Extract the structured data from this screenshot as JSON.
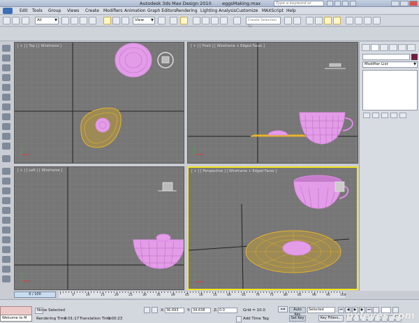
{
  "window": {
    "app_title": "Autodesk 3ds Max Design 2010",
    "file_name": "eggsMaking.max",
    "help_search_placeholder": "Type a keyword or phrase"
  },
  "menu": [
    "Edit",
    "Tools",
    "Group",
    "Views",
    "Create",
    "Modifiers",
    "Animation",
    "Graph Editors",
    "Rendering",
    "Lighting Analysis",
    "Customize",
    "MAXScript",
    "Help"
  ],
  "toolbar": {
    "selection_filter": "All",
    "reference_coord": "View",
    "named_selection_placeholder": "Create Selection Se"
  },
  "viewports": {
    "top_label": "[ + ] [ Top ] [ Wireframe ]",
    "front_label": "[ + ] [ Front ] [ Wireframe + Edged Faces ]",
    "left_label": "[ + ] [ Left ] [ Wireframe ]",
    "persp_label": "[ + ] [ Perspective ] [ Wireframe + Edged Faces ]"
  },
  "command_panel": {
    "modifier_list": "Modifier List",
    "object_color": "#7a1840"
  },
  "timeline": {
    "frame_counter": "0 / 100",
    "ticks": [
      "5",
      "10",
      "15",
      "20",
      "25",
      "30",
      "35",
      "40",
      "45",
      "50",
      "55",
      "60",
      "65",
      "70",
      "75",
      "80",
      "85",
      "90",
      "95",
      "100"
    ]
  },
  "status": {
    "maxscript_label": "Welcome to M",
    "selection": "None Selected",
    "render_time_label": "Rendering Time",
    "render_time_value": "0:01:17",
    "translation_time_label": "Translation Time",
    "translation_time_value": "0:00:23",
    "x_label": "X:",
    "x_value": "36.693",
    "y_label": "Y:",
    "y_value": "34.638",
    "z_label": "Z:",
    "z_value": "0.0",
    "grid": "Grid = 10.0",
    "add_time_tag": "Add Time Tag",
    "auto_key": "Auto Key",
    "set_key": "Set Key",
    "key_mode": "Selected",
    "key_filters": "Key Filters..."
  },
  "watermark": "pxleyes.com",
  "colors": {
    "wire_pink": "#e08ae8",
    "wire_yellow": "#e8b52a",
    "active_viewport": "#f2e51e"
  }
}
